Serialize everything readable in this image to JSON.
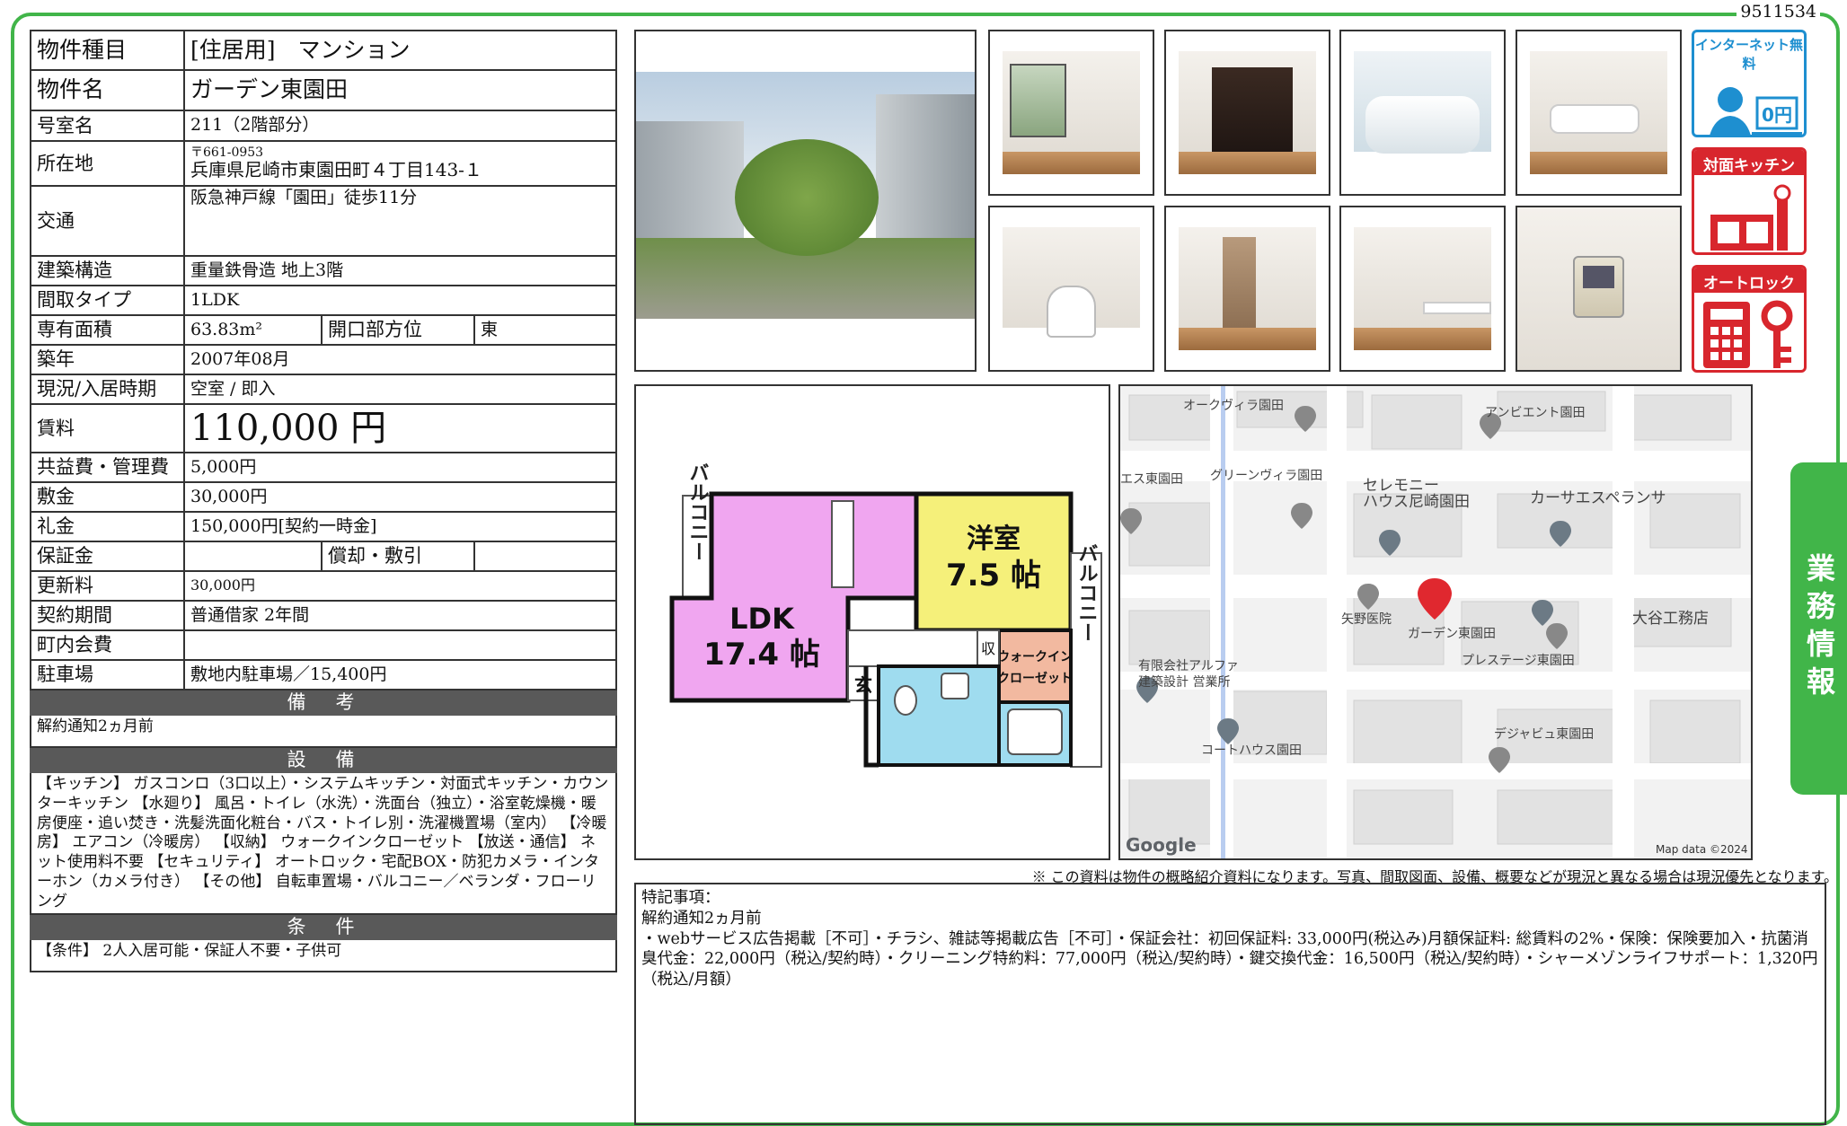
{
  "doc_id": "9511534",
  "property": {
    "type_label": "物件種目",
    "type_value": "[住居用]　マンション",
    "name_label": "物件名",
    "name_value": "ガーデン東園田",
    "room_label": "号室名",
    "room_value": "211（2階部分）",
    "address_label": "所在地",
    "address_zip": "〒661-0953",
    "address_value": "兵庫県尼崎市東園田町４丁目143-１",
    "transport_label": "交通",
    "transport_value": "阪急神戸線「園田」徒歩11分",
    "structure_label": "建築構造",
    "structure_value": "重量鉄骨造 地上3階",
    "layout_label": "間取タイプ",
    "layout_value": "1LDK",
    "area_label": "専有面積",
    "area_value": "63.83m²",
    "direction_label": "開口部方位",
    "direction_value": "東",
    "built_label": "築年",
    "built_value": "2007年08月",
    "status_label": "現況/入居時期",
    "status_value": "空室 / 即入",
    "rent_label": "賃料",
    "rent_value": "110,000 円",
    "fee_label": "共益費・管理費",
    "fee_value": "5,000円",
    "deposit_label": "敷金",
    "deposit_value": "30,000円",
    "key_money_label": "礼金",
    "key_money_value": "150,000円[契約一時金]",
    "guarantee_label": "保証金",
    "guarantee_value": "",
    "amortization_label": "償却・敷引",
    "amortization_value": "",
    "renewal_label": "更新料",
    "renewal_value": "30,000円",
    "term_label": "契約期間",
    "term_value": "普通借家 2年間",
    "association_label": "町内会費",
    "association_value": "",
    "parking_label": "駐車場",
    "parking_value": "敷地内駐車場／15,400円"
  },
  "sections": {
    "remarks_title": "備　考",
    "remarks_text": "解約通知2ヵ月前",
    "equipment_title": "設　備",
    "equipment_text": "【キッチン】 ガスコンロ（3口以上）・システムキッチン・対面式キッチン・カウンターキッチン 【水廻り】 風呂・トイレ（水洗）・洗面台（独立）・浴室乾燥機・暖房便座・追い焚き・洗髪洗面化粧台・バス・トイレ別・洗濯機置場（室内） 【冷暖房】 エアコン（冷暖房） 【収納】 ウォークインクローゼット 【放送・通信】 ネット使用料不要 【セキュリティ】 オートロック・宅配BOX・防犯カメラ・インターホン（カメラ付き） 【その他】 自転車置場・バルコニー／ベランダ・フローリング",
    "conditions_title": "条　件",
    "conditions_text": "【条件】 2人入居可能・保証人不要・子供可"
  },
  "badges": {
    "internet": "インターネット無料",
    "internet_sub": "0円",
    "kitchen": "対面キッチン",
    "autolock": "オートロック"
  },
  "floor_plan": {
    "balcony_left": "バルコニー",
    "balcony_right": "バルコニー",
    "ldk": "LDK",
    "ldk_size": "17.4 帖",
    "western": "洋室",
    "western_size": "7.5 帖",
    "wic1": "ウォークイン",
    "wic2": "クローゼット",
    "entrance": "玄",
    "storage": "収"
  },
  "map": {
    "labels": [
      "オークヴィラ園田",
      "アンビエント園田",
      "エス東園田",
      "グリーンヴィラ園田",
      "セレモニー",
      "ハウス尼崎園田",
      "カーサエスペランサ",
      "矢野医院",
      "ガーデン東園田",
      "大谷工務店",
      "有限会社アルファ",
      "建築設計 営業所",
      "プレステージ東園田",
      "コートハウス園田",
      "デジャビュ東園田"
    ],
    "google": "Google",
    "attribution": "Map data ©2024"
  },
  "note": "※ この資料は物件の概略紹介資料になります。写真、間取図面、設備、概要などが現況と異なる場合は現況優先となります。",
  "special": {
    "title": "特記事項：",
    "line1": "解約通知2ヵ月前",
    "line2": "・webサービス広告掲載［不可］・チラシ、雑誌等掲載広告［不可］・保証会社：初回保証料: 33,000円(税込み)月額保証料: 総賃料の2%・保険：保険要加入・抗菌消臭代金：22,000円（税込/契約時）・クリーニング特約料：77,000円（税込/契約時）・鍵交換代金：16,500円（税込/契約時）・シャーメゾンライフサポート：1,320円（税込/月額）"
  },
  "side_tab": "業務情報",
  "colors": {
    "frame": "#41b549",
    "section_bg": "#595959",
    "plan_ldk": "#f0a6f0",
    "plan_western": "#f5f07a",
    "plan_bath": "#9fdcef",
    "plan_wic": "#f2b9a0",
    "map_pin": "#e0282f"
  }
}
